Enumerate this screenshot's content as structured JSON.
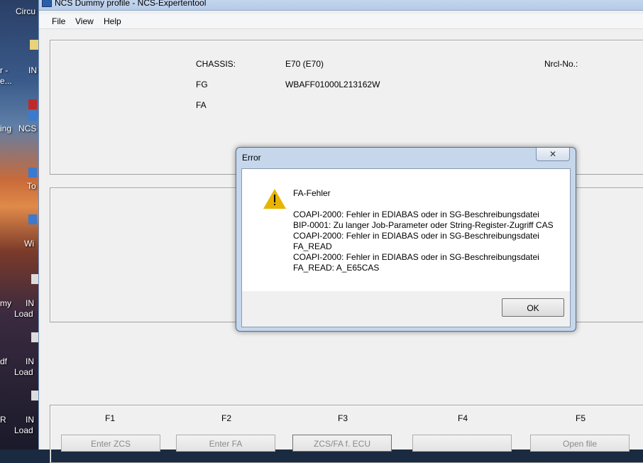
{
  "desktop": {
    "labels": [
      "Circu",
      "IN",
      "r -",
      "e...",
      "ing",
      "NCS",
      "To",
      "Wi",
      "my",
      "IN",
      "Load",
      "df",
      "IN",
      "Load",
      "R",
      "IN",
      "Load"
    ]
  },
  "window": {
    "title": "NCS Dummy profile - NCS-Expertentool"
  },
  "menu": {
    "file": "File",
    "view": "View",
    "help": "Help"
  },
  "info": {
    "chassis_label": "CHASSIS:",
    "chassis_value": "E70 (E70)",
    "fg_label": "FG",
    "fg_value": "WBAFF01000L213162W",
    "fa_label": "FA",
    "nrcl_label": "Nrcl-No.:"
  },
  "fkeys": {
    "labels": [
      "F1",
      "F2",
      "F3",
      "F4",
      "F5"
    ],
    "buttons": [
      "Enter ZCS",
      "Enter FA",
      "ZCS/FA f. ECU",
      "",
      "Open file"
    ]
  },
  "dialog": {
    "title": "Error",
    "close": "✕",
    "heading": "FA-Fehler",
    "lines": [
      "COAPI-2000: Fehler in EDIABAS oder in SG-Beschreibungsdatei",
      "BIP-0001: Zu langer Job-Parameter oder String-Register-Zugriff  CAS",
      "COAPI-2000: Fehler in EDIABAS oder in SG-Beschreibungsdatei",
      "FA_READ",
      "COAPI-2000: Fehler in EDIABAS oder in SG-Beschreibungsdatei",
      "FA_READ: A_E65CAS"
    ],
    "ok": "OK"
  }
}
